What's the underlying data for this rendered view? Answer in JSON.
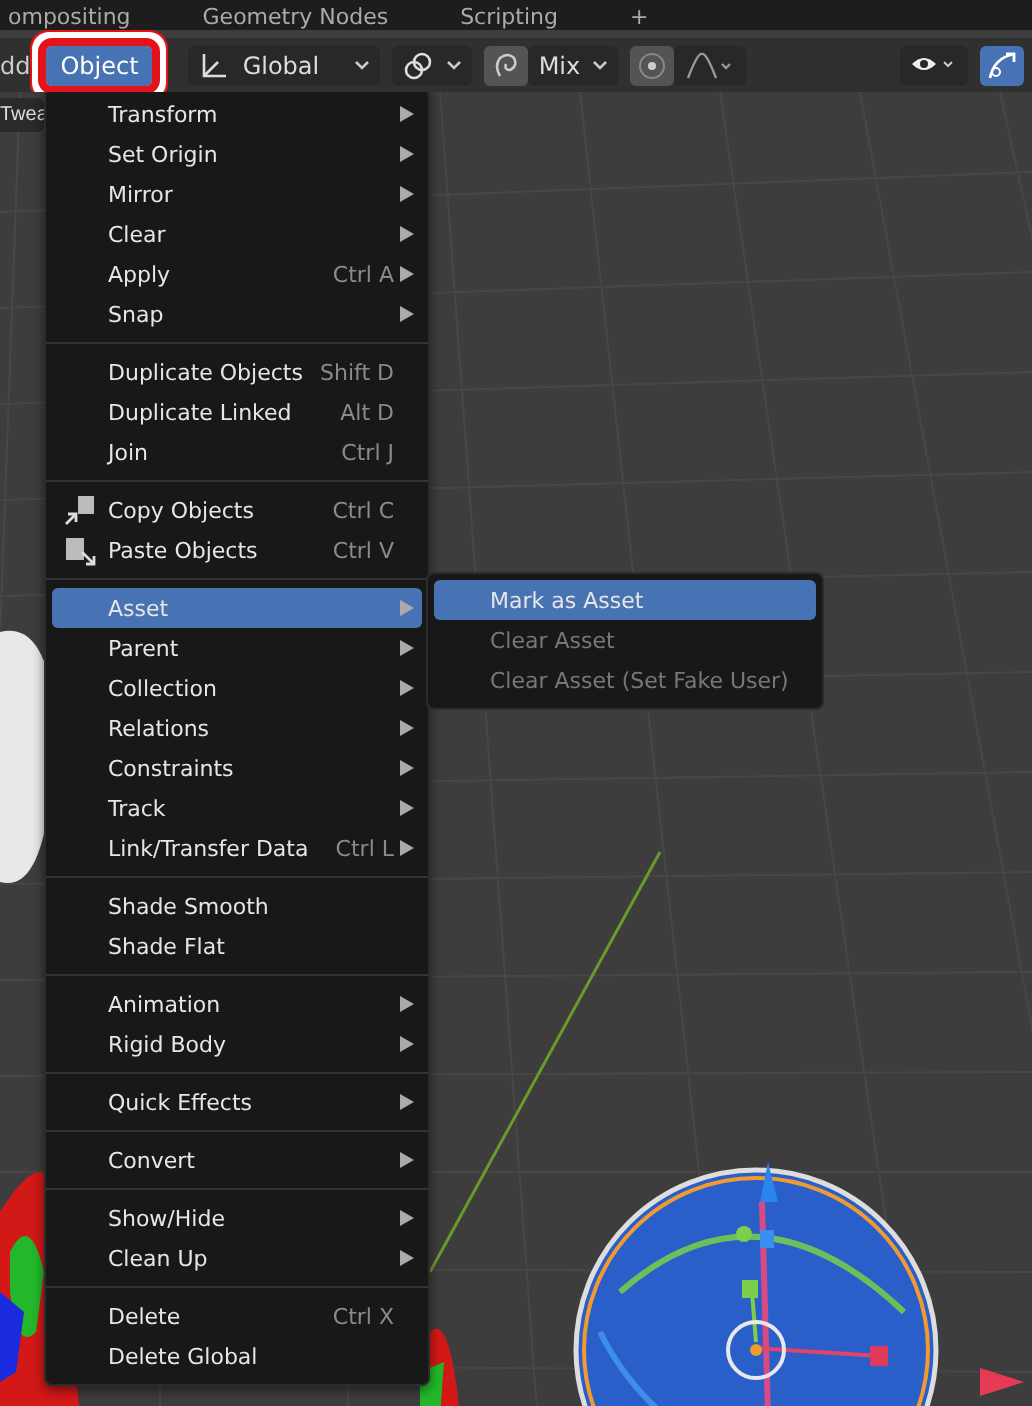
{
  "workspace_tabs": [
    {
      "label": "ompositing",
      "selected": false
    },
    {
      "label": "Geometry Nodes",
      "selected": false
    },
    {
      "label": "Scripting",
      "selected": false
    },
    {
      "label": "+",
      "selected": false
    }
  ],
  "header": {
    "add_menu": "dd",
    "object_menu": {
      "label": "Object",
      "selected": true,
      "highlighted": true
    },
    "orientation": "Global",
    "pivot_mode": "Mix"
  },
  "tool_tab": "Twea",
  "menu": {
    "sections": [
      [
        {
          "label": "Transform",
          "submenu": true,
          "selected": false,
          "kind": "plain"
        },
        {
          "label": "Set Origin",
          "submenu": true,
          "selected": false,
          "kind": "plain"
        },
        {
          "label": "Mirror",
          "submenu": true,
          "selected": false,
          "kind": "plain"
        },
        {
          "label": "Clear",
          "submenu": true,
          "selected": false,
          "kind": "plain"
        },
        {
          "label": "Apply",
          "shortcut": "Ctrl A",
          "submenu": true,
          "selected": false,
          "kind": "plain"
        },
        {
          "label": "Snap",
          "submenu": true,
          "selected": false,
          "kind": "plain"
        }
      ],
      [
        {
          "label": "Duplicate Objects",
          "shortcut": "Shift D",
          "submenu": false,
          "selected": false,
          "kind": "plain"
        },
        {
          "label": "Duplicate Linked",
          "shortcut": "Alt D",
          "submenu": false,
          "selected": false,
          "kind": "plain"
        },
        {
          "label": "Join",
          "shortcut": "Ctrl J",
          "submenu": false,
          "selected": false,
          "kind": "plain"
        }
      ],
      [
        {
          "label": "Copy Objects",
          "shortcut": "Ctrl C",
          "submenu": false,
          "selected": false,
          "kind": "copy"
        },
        {
          "label": "Paste Objects",
          "shortcut": "Ctrl V",
          "submenu": false,
          "selected": false,
          "kind": "paste"
        }
      ],
      [
        {
          "label": "Asset",
          "submenu": true,
          "selected": true,
          "kind": "plain"
        },
        {
          "label": "Parent",
          "submenu": true,
          "selected": false,
          "kind": "plain"
        },
        {
          "label": "Collection",
          "submenu": true,
          "selected": false,
          "kind": "plain"
        },
        {
          "label": "Relations",
          "submenu": true,
          "selected": false,
          "kind": "plain"
        },
        {
          "label": "Constraints",
          "submenu": true,
          "selected": false,
          "kind": "plain"
        },
        {
          "label": "Track",
          "submenu": true,
          "selected": false,
          "kind": "plain"
        },
        {
          "label": "Link/Transfer Data",
          "shortcut": "Ctrl L",
          "submenu": true,
          "selected": false,
          "kind": "plain"
        }
      ],
      [
        {
          "label": "Shade Smooth",
          "submenu": false,
          "selected": false,
          "kind": "plain"
        },
        {
          "label": "Shade Flat",
          "submenu": false,
          "selected": false,
          "kind": "plain"
        }
      ],
      [
        {
          "label": "Animation",
          "submenu": true,
          "selected": false,
          "kind": "plain"
        },
        {
          "label": "Rigid Body",
          "submenu": true,
          "selected": false,
          "kind": "plain"
        }
      ],
      [
        {
          "label": "Quick Effects",
          "submenu": true,
          "selected": false,
          "kind": "plain"
        }
      ],
      [
        {
          "label": "Convert",
          "submenu": true,
          "selected": false,
          "kind": "plain"
        }
      ],
      [
        {
          "label": "Show/Hide",
          "submenu": true,
          "selected": false,
          "kind": "plain"
        },
        {
          "label": "Clean Up",
          "submenu": true,
          "selected": false,
          "kind": "plain"
        }
      ],
      [
        {
          "label": "Delete",
          "shortcut": "Ctrl X",
          "submenu": false,
          "selected": false,
          "kind": "plain"
        },
        {
          "label": "Delete Global",
          "submenu": false,
          "selected": false,
          "kind": "plain"
        }
      ]
    ]
  },
  "submenu": {
    "items": [
      {
        "label": "Mark as Asset",
        "selected": true,
        "disabled": false
      },
      {
        "label": "Clear Asset",
        "selected": false,
        "disabled": true
      },
      {
        "label": "Clear Asset (Set Fake User)",
        "selected": false,
        "disabled": true
      }
    ]
  }
}
